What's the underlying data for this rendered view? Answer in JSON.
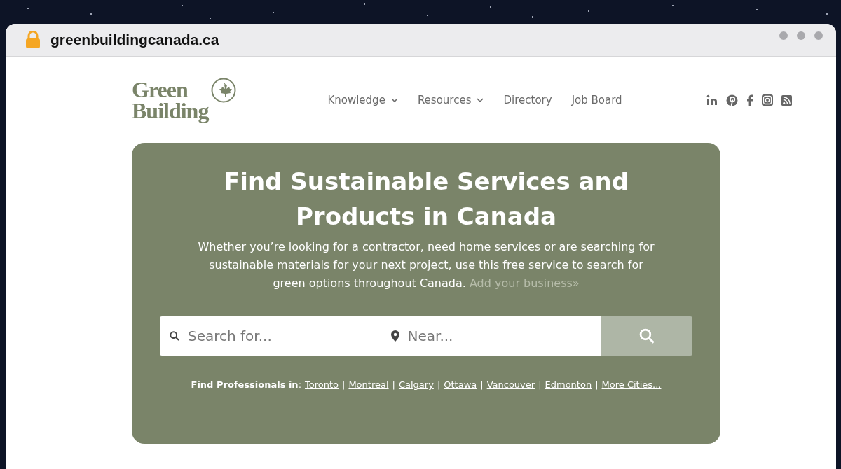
{
  "browser": {
    "url": "greenbuildingcanada.ca"
  },
  "logo": {
    "line_1": "Green",
    "line_2": "Building"
  },
  "nav": [
    {
      "label": "Knowledge",
      "dropdown": true
    },
    {
      "label": "Resources",
      "dropdown": true
    },
    {
      "label": "Directory",
      "dropdown": false
    },
    {
      "label": "Job Board",
      "dropdown": false
    }
  ],
  "social": [
    {
      "kind": "linkedin"
    },
    {
      "kind": "pinterest"
    },
    {
      "kind": "facebook"
    },
    {
      "kind": "instagram"
    },
    {
      "kind": "rss"
    }
  ],
  "hero": {
    "title": "Find Sustainable Services and Products in Canada",
    "text": "Whether you’re looking for a contractor, need home services or are searching for sustainable materials for your next project, use this free service to search for green options throughout Canada.",
    "link": "Add your business»",
    "search": {
      "placeholder": "Search for..."
    },
    "near": {
      "placeholder": "Near..."
    },
    "cities_label": "**Find Professionals in**:",
    "separator": "|",
    "cities": [
      "Toronto",
      "Montreal",
      "Calgary",
      "Ottawa",
      "Vancouver",
      "Edmonton",
      "More Cities..."
    ]
  }
}
